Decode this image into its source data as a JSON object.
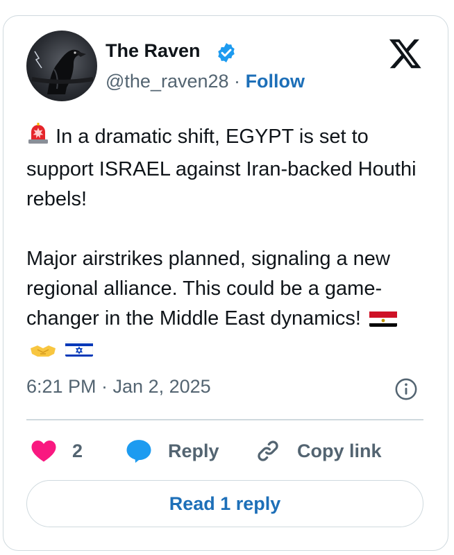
{
  "author": {
    "name": "The Raven",
    "handle": "@the_raven28",
    "separator": "·",
    "follow_label": "Follow",
    "verified_icon": "verified-badge-icon",
    "verified_color": "#1d9bf0"
  },
  "platform_icon": "x-logo-icon",
  "post": {
    "alert_emoji": "🚨",
    "paragraph1": "In a dramatic shift, EGYPT is set to support ISRAEL against Iran-backed Houthi rebels!",
    "paragraph2": "Major airstrikes planned, signaling a new regional alliance. This could be a game-changer in the Middle East dynamics!",
    "trailing_emojis": [
      "egypt-flag",
      "handshake",
      "israel-flag"
    ]
  },
  "timestamp": "6:21 PM · Jan 2, 2025",
  "actions": {
    "like_count": "2",
    "reply_label": "Reply",
    "copy_link_label": "Copy link"
  },
  "read_replies_label": "Read 1 reply",
  "colors": {
    "accent": "#1d6fb8",
    "like": "#f91880",
    "reply_icon": "#1d9bf0",
    "muted": "#536471",
    "border": "#cfd9de"
  }
}
